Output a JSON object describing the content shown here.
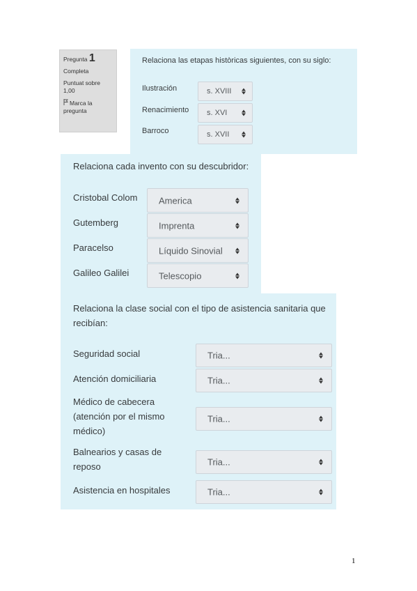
{
  "question_info": {
    "question_label": "Pregunta",
    "question_number": "1",
    "state": "Completa",
    "score": "Puntuat sobre 1,00",
    "flag_label": "Marca la pregunta"
  },
  "q1": {
    "text": "Relaciona las etapas històricas siguientes, con su siglo:",
    "rows": [
      {
        "label": "Ilustración",
        "value": "s. XVIII"
      },
      {
        "label": "Renacimiento",
        "value": "s. XVI"
      },
      {
        "label": "Barroco",
        "value": "s. XVII"
      }
    ]
  },
  "q2": {
    "text": "Relaciona cada invento con su descubridor:",
    "rows": [
      {
        "label": "Cristobal Colom",
        "value": "America"
      },
      {
        "label": "Gutemberg",
        "value": "Imprenta"
      },
      {
        "label": "Paracelso",
        "value": "Líquido Sinovial"
      },
      {
        "label": "Galileo Galilei",
        "value": "Telescopio"
      }
    ]
  },
  "q3": {
    "text": "Relaciona la clase social con el tipo de asistencia sanitaria que recibían:",
    "rows": [
      {
        "label": "Seguridad social",
        "value": "Tria..."
      },
      {
        "label": "Atención domiciliaria",
        "value": "Tria..."
      },
      {
        "label": "Médico de cabecera (atención por el mismo médico)",
        "value": "Tria..."
      },
      {
        "label": "Balnearios y casas de reposo",
        "value": "Tria..."
      },
      {
        "label": "Asistencia en hospitales",
        "value": "Tria..."
      }
    ]
  },
  "page_number": "1"
}
